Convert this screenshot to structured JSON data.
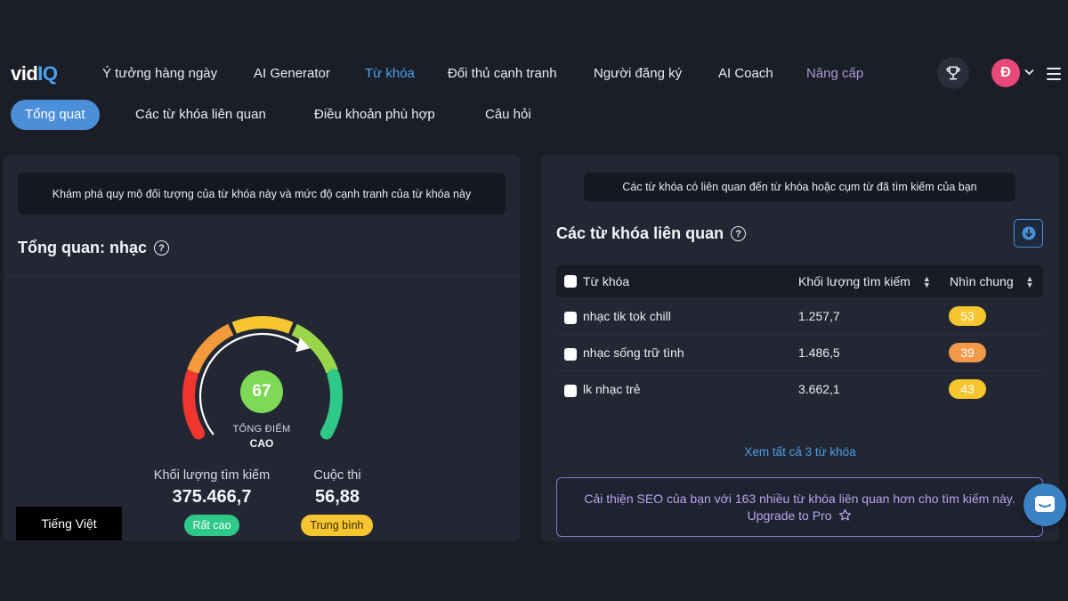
{
  "logo": {
    "vid": "vid",
    "iq": "IQ"
  },
  "nav": {
    "items": [
      {
        "label": "Ý tưởng hàng ngày"
      },
      {
        "label": "AI Generator"
      },
      {
        "label": "Từ khóa"
      },
      {
        "label": "Đối thủ cạnh tranh"
      },
      {
        "label": "Người đăng ký"
      },
      {
        "label": "AI Coach"
      },
      {
        "label": "Nâng cấp"
      }
    ],
    "active_index": 2,
    "avatar_letter": "Đ",
    "icons": [
      "trophy-icon",
      "chevron-down-icon",
      "hamburger-menu-icon"
    ]
  },
  "subtabs": [
    {
      "label": "Tổng quat"
    },
    {
      "label": "Các từ khóa liên quan"
    },
    {
      "label": "Điều khoản phù hợp"
    },
    {
      "label": "Câu hỏi"
    }
  ],
  "overview": {
    "info": "Khám phá quy mô đối tượng của từ khóa này và mức độ cạnh tranh của từ khóa này",
    "title": "Tổng quan: nhạc",
    "score": "67",
    "score_label": "TỔNG ĐIỂM",
    "score_level": "CAO",
    "gauge": {
      "value": 67,
      "max": 100,
      "segment_colors": [
        "#f0362f",
        "#f39a3a",
        "#f6c630",
        "#9ad64a",
        "#2ec986"
      ]
    },
    "search_volume": {
      "label": "Khối lượng tìm kiếm",
      "value": "375.466,7",
      "badge": "Rất cao"
    },
    "competition": {
      "label": "Cuộc thi",
      "value": "56,88",
      "badge": "Trung bình"
    }
  },
  "language": "Tiếng Việt",
  "related": {
    "info": "Các từ khóa có liên quan đến từ khóa hoặc cụm từ đã tìm kiếm của bạn",
    "title": "Các từ khóa liên quan",
    "columns": [
      "Từ khóa",
      "Khối lượng tìm kiếm",
      "Nhìn chung"
    ],
    "rows": [
      {
        "keyword": "nhạc tik tok chill",
        "volume": "1.257,7",
        "score": "53",
        "color": "#f6c630"
      },
      {
        "keyword": "nhạc sống trữ tình",
        "volume": "1.486,5",
        "score": "39",
        "color": "#f39a4a"
      },
      {
        "keyword": "lk nhạc trẻ",
        "volume": "3.662,1",
        "score": "43",
        "color": "#f6c630"
      }
    ],
    "see_all": "Xem tất cả 3 từ khóa",
    "upgrade_text": "Cải thiện SEO của bạn với 163 nhiều từ khóa liên quan hơn cho tìm kiếm này. Upgrade to Pro"
  }
}
